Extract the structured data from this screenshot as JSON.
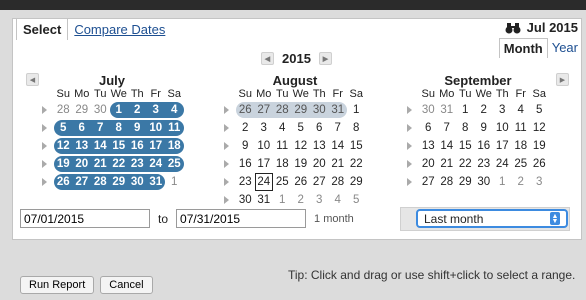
{
  "tabs": [
    {
      "label": "Select"
    },
    {
      "label": "Compare Dates"
    }
  ],
  "period": {
    "label": "Jul 2015"
  },
  "view_tabs": [
    {
      "label": "Month"
    },
    {
      "label": "Year"
    }
  ],
  "year": "2015",
  "dow": [
    "Su",
    "Mo",
    "Tu",
    "We",
    "Th",
    "Fr",
    "Sa"
  ],
  "months": [
    {
      "name": "July",
      "weeks": [
        [
          "28",
          "29",
          "30",
          "1",
          "2",
          "3",
          "4"
        ],
        [
          "5",
          "6",
          "7",
          "8",
          "9",
          "10",
          "11"
        ],
        [
          "12",
          "13",
          "14",
          "15",
          "16",
          "17",
          "18"
        ],
        [
          "19",
          "20",
          "21",
          "22",
          "23",
          "24",
          "25"
        ],
        [
          "26",
          "27",
          "28",
          "29",
          "30",
          "31",
          "1"
        ]
      ]
    },
    {
      "name": "August",
      "weeks": [
        [
          "26",
          "27",
          "28",
          "29",
          "30",
          "31",
          "1"
        ],
        [
          "2",
          "3",
          "4",
          "5",
          "6",
          "7",
          "8"
        ],
        [
          "9",
          "10",
          "11",
          "12",
          "13",
          "14",
          "15"
        ],
        [
          "16",
          "17",
          "18",
          "19",
          "20",
          "21",
          "22"
        ],
        [
          "23",
          "24",
          "25",
          "26",
          "27",
          "28",
          "29"
        ],
        [
          "30",
          "31",
          "1",
          "2",
          "3",
          "4",
          "5"
        ]
      ]
    },
    {
      "name": "September",
      "weeks": [
        [
          "30",
          "31",
          "1",
          "2",
          "3",
          "4",
          "5"
        ],
        [
          "6",
          "7",
          "8",
          "9",
          "10",
          "11",
          "12"
        ],
        [
          "13",
          "14",
          "15",
          "16",
          "17",
          "18",
          "19"
        ],
        [
          "20",
          "21",
          "22",
          "23",
          "24",
          "25",
          "26"
        ],
        [
          "27",
          "28",
          "29",
          "30",
          "1",
          "2",
          "3"
        ]
      ]
    }
  ],
  "range": {
    "from": "07/01/2015",
    "to_label": "to",
    "to": "07/31/2015",
    "span": "1 month"
  },
  "preset": {
    "selected": "Last month"
  },
  "tip": "Tip: Click and drag or use shift+click to select a range.",
  "buttons": {
    "run": "Run Report",
    "cancel": "Cancel"
  },
  "colors": {
    "selected": "#3b78a6",
    "previous": "#c9d3dd",
    "focus": "#3d8be0"
  }
}
